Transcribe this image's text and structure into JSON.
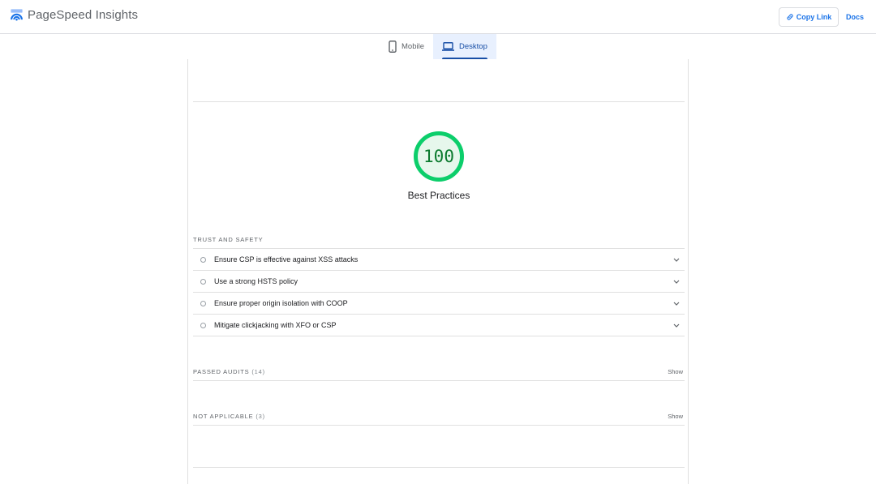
{
  "header": {
    "app_name": "PageSpeed Insights",
    "logo_icon": "pagespeed-logo-icon",
    "copy_link_label": "Copy Link",
    "copy_link_icon": "link-icon",
    "docs_label": "Docs"
  },
  "tabs": [
    {
      "label": "Mobile",
      "icon": "smartphone-icon",
      "active": false
    },
    {
      "label": "Desktop",
      "icon": "laptop-icon",
      "active": true
    }
  ],
  "score": {
    "value": "100",
    "label": "Best Practices",
    "color": "#0cce6b"
  },
  "trust_safety": {
    "title": "TRUST AND SAFETY",
    "audits": [
      "Ensure CSP is effective against XSS attacks",
      "Use a strong HSTS policy",
      "Ensure proper origin isolation with COOP",
      "Mitigate clickjacking with XFO or CSP"
    ]
  },
  "passed_audits": {
    "title": "PASSED AUDITS",
    "count": "(14)",
    "show_label": "Show"
  },
  "not_applicable": {
    "title": "NOT APPLICABLE",
    "count": "(3)",
    "show_label": "Show"
  },
  "colors": {
    "accent": "#1a73e8",
    "pass": "#0cce6b",
    "active_tab_bg": "#e8f0fe"
  }
}
